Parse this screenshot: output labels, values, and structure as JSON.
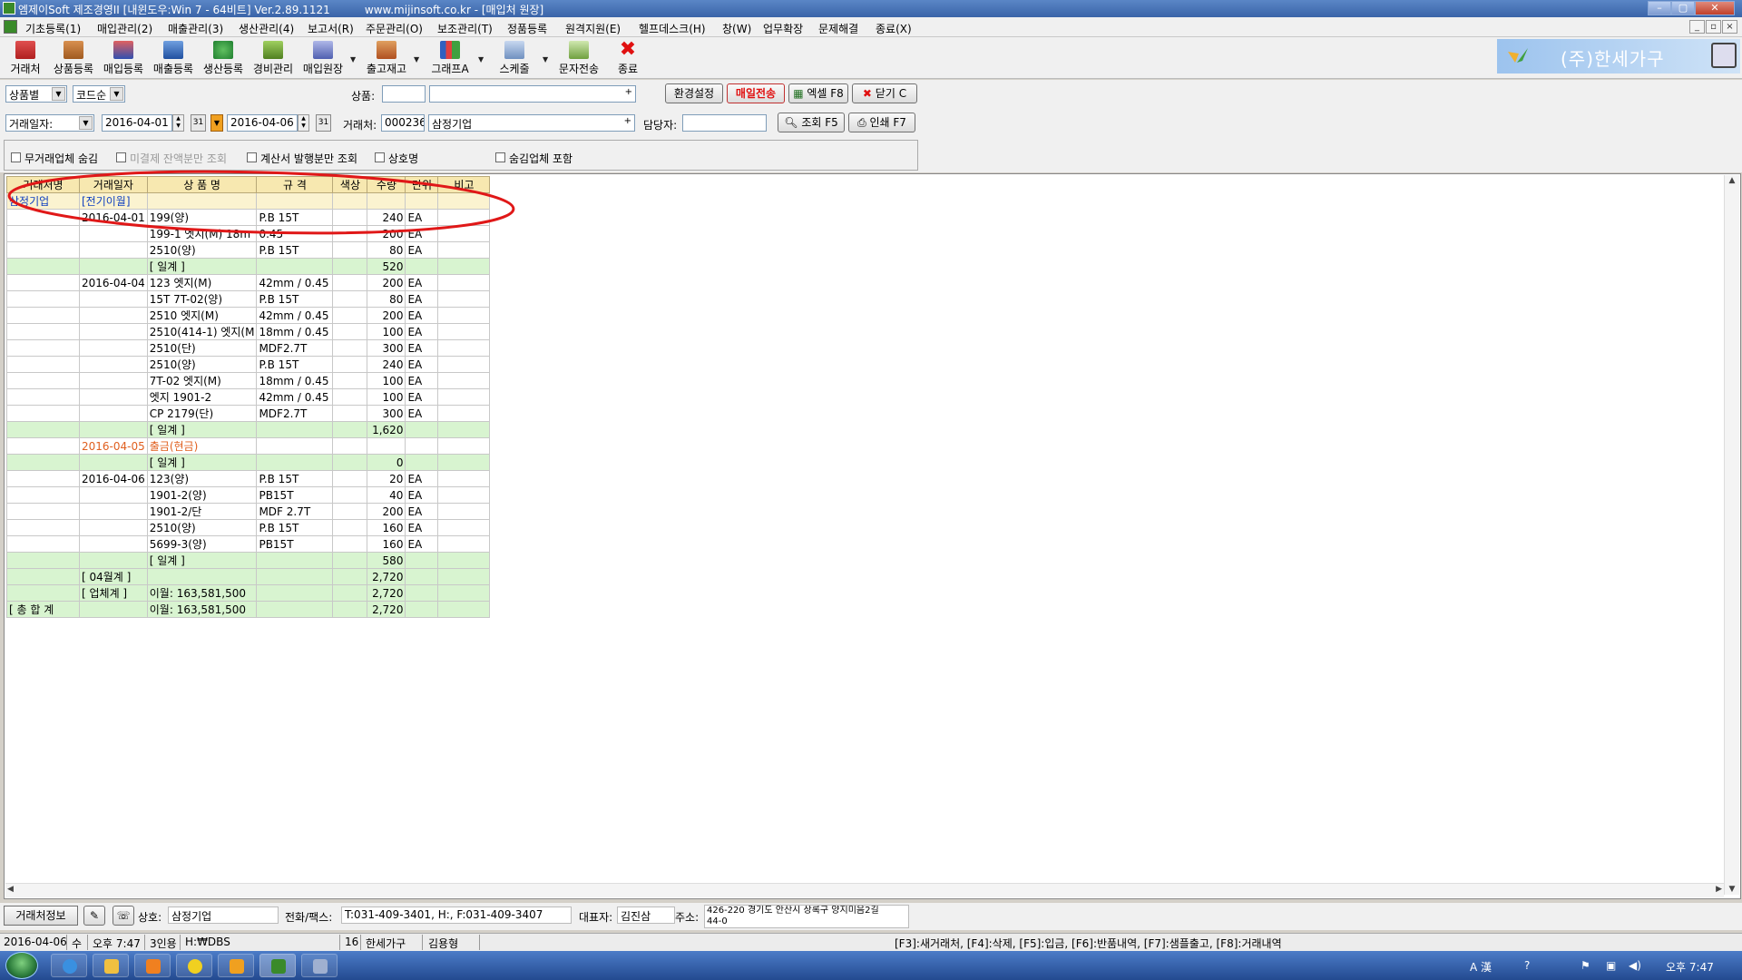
{
  "window": {
    "title": "엠제이Soft 제조경영II [내윈도우:Win 7 - 64비트] Ver.2.89.1121",
    "url": "www.mijinsoft.co.kr - [매입처 원장]"
  },
  "menu": [
    "기초등록(1)",
    "매입관리(2)",
    "매출관리(3)",
    "생산관리(4)",
    "보고서(R)",
    "주문관리(O)",
    "보조관리(T)",
    "정품등록",
    "원격지원(E)",
    "헬프데스크(H)",
    "창(W)",
    "업무확장",
    "문제해결",
    "종료(X)"
  ],
  "toolbar": [
    "거래처",
    "상품등록",
    "매입등록",
    "매출등록",
    "생산등록",
    "경비관리",
    "매입원장",
    "출고재고",
    "그래프A",
    "스케줄",
    "문자전송",
    "종료"
  ],
  "company_name": "(주)한세가구",
  "filters": {
    "group_by": "상품별",
    "order_by": "코드순",
    "product_label": "상품:",
    "product_code": "",
    "product_name": "",
    "date_type": "거래일자:",
    "date_from": "2016-04-01",
    "date_to": "2016-04-06",
    "client_label": "거래처:",
    "client_code": "000236",
    "client_name": "삼정기업",
    "manager_label": "담당자:",
    "manager": "",
    "btn_env": "환경설정",
    "btn_send": "매일전송",
    "btn_excel": "엑셀 F8",
    "btn_close": "닫기 C",
    "btn_search": "조회 F5",
    "btn_print": "인쇄 F7",
    "opt1": "무거래업체 숨김",
    "opt2": "미결제 잔액분만 조회",
    "opt3": "계산서 발행분만 조회",
    "opt4": "상호명",
    "opt5": "숨김업체 포함"
  },
  "grid": {
    "headers": [
      "거래처명",
      "거래일자",
      "상 품 명",
      "규 격",
      "색상",
      "수량",
      "단위",
      "비고"
    ],
    "rows": [
      {
        "t": "client",
        "c": [
          "삼정기업",
          "[전기이월]",
          "",
          "",
          "",
          "",
          "",
          ""
        ]
      },
      {
        "c": [
          "",
          "2016-04-01",
          "199(양)",
          "P.B 15T",
          "",
          "240",
          "EA",
          ""
        ]
      },
      {
        "c": [
          "",
          "",
          "199-1 엣지(M) 18m",
          "0.45",
          "",
          "200",
          "EA",
          ""
        ]
      },
      {
        "c": [
          "",
          "",
          "2510(양)",
          "P.B 15T",
          "",
          "80",
          "EA",
          ""
        ]
      },
      {
        "t": "sum",
        "c": [
          "",
          "",
          "[ 일계 ]",
          "",
          "",
          "520",
          "",
          ""
        ]
      },
      {
        "c": [
          "",
          "2016-04-04",
          "123 엣지(M)",
          "42mm / 0.45",
          "",
          "200",
          "EA",
          ""
        ]
      },
      {
        "c": [
          "",
          "",
          "15T 7T-02(양)",
          "P.B 15T",
          "",
          "80",
          "EA",
          ""
        ]
      },
      {
        "c": [
          "",
          "",
          "2510 엣지(M)",
          "42mm / 0.45",
          "",
          "200",
          "EA",
          ""
        ]
      },
      {
        "c": [
          "",
          "",
          "2510(414-1) 엣지(M",
          "18mm / 0.45",
          "",
          "100",
          "EA",
          ""
        ]
      },
      {
        "c": [
          "",
          "",
          "2510(단)",
          "MDF2.7T",
          "",
          "300",
          "EA",
          ""
        ]
      },
      {
        "c": [
          "",
          "",
          "2510(양)",
          "P.B 15T",
          "",
          "240",
          "EA",
          ""
        ]
      },
      {
        "c": [
          "",
          "",
          "7T-02 엣지(M)",
          "18mm / 0.45",
          "",
          "100",
          "EA",
          ""
        ]
      },
      {
        "c": [
          "",
          "",
          "엣지 1901-2",
          "42mm / 0.45",
          "",
          "100",
          "EA",
          ""
        ]
      },
      {
        "c": [
          "",
          "",
          "CP 2179(단)",
          "MDF2.7T",
          "",
          "300",
          "EA",
          ""
        ]
      },
      {
        "t": "sum",
        "c": [
          "",
          "",
          "[ 일계 ]",
          "",
          "",
          "1,620",
          "",
          ""
        ]
      },
      {
        "t": "pay",
        "c": [
          "",
          "2016-04-05",
          "출금(현금)",
          "",
          "",
          "",
          "",
          ""
        ]
      },
      {
        "t": "sum",
        "c": [
          "",
          "",
          "[ 일계 ]",
          "",
          "",
          "0",
          "",
          ""
        ]
      },
      {
        "c": [
          "",
          "2016-04-06",
          "123(양)",
          "P.B 15T",
          "",
          "20",
          "EA",
          ""
        ]
      },
      {
        "c": [
          "",
          "",
          "1901-2(양)",
          "PB15T",
          "",
          "40",
          "EA",
          ""
        ]
      },
      {
        "c": [
          "",
          "",
          "1901-2/단",
          "MDF 2.7T",
          "",
          "200",
          "EA",
          ""
        ]
      },
      {
        "c": [
          "",
          "",
          "2510(양)",
          "P.B 15T",
          "",
          "160",
          "EA",
          ""
        ]
      },
      {
        "c": [
          "",
          "",
          "5699-3(양)",
          "PB15T",
          "",
          "160",
          "EA",
          ""
        ]
      },
      {
        "t": "sum",
        "c": [
          "",
          "",
          "[ 일계 ]",
          "",
          "",
          "580",
          "",
          ""
        ]
      },
      {
        "t": "msum",
        "c": [
          "",
          "[ 04월계 ]",
          "",
          "",
          "",
          "2,720",
          "",
          ""
        ]
      },
      {
        "t": "msum",
        "c": [
          "",
          "[ 업체계 ]",
          "이월: 163,581,500",
          "",
          "",
          "2,720",
          "",
          ""
        ]
      },
      {
        "t": "msum",
        "c": [
          "[ 총 합 계",
          "",
          "이월: 163,581,500",
          "",
          "",
          "2,720",
          "",
          ""
        ]
      }
    ]
  },
  "info": {
    "btn_info": "거래처정보",
    "name_label": "상호:",
    "name": "삼정기업",
    "phone_label": "전화/팩스:",
    "phone": "T:031-409-3401, H:, F:031-409-3407",
    "ceo_label": "대표자:",
    "ceo": "김진삼",
    "addr_label": "주소:",
    "addr1": "426-220 경기도 안산시 상록구 양지미음2길",
    "addr2": "44-0"
  },
  "status": {
    "date": "2016-04-06",
    "weekday": "수",
    "time": "오후 7:47",
    "users": "3인용",
    "db": "H:₩DBS",
    "num": "16",
    "company": "한세가구",
    "user": "김용형",
    "help": "[F3]:새거래처, [F4]:삭제, [F5]:입금, [F6]:반품내역, [F7]:샘플출고, [F8]:거래내역"
  },
  "taskbar": {
    "clock": "오후 7:47",
    "ime": "A 漢"
  },
  "colors": {
    "header_bg": "#f7e8b0",
    "sum_bg": "#d8f4d0",
    "client_text": "#1040c0",
    "payment_text": "#e06020",
    "annotation": "#e01818"
  }
}
